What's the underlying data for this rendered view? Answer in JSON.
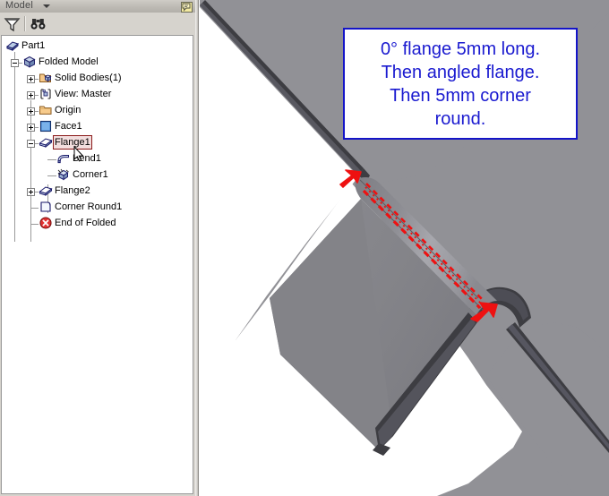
{
  "panel": {
    "title": "Model",
    "caret_icon": "chevron-down-icon",
    "dock_icon": "dock-pin-icon",
    "toolbar": [
      {
        "name": "filter-button",
        "icon": "filter-funnel-icon"
      },
      {
        "name": "find-button",
        "icon": "binoculars-icon"
      }
    ]
  },
  "tree": {
    "items": [
      {
        "label": "Part1",
        "icon": "part-icon",
        "indent": 0,
        "expander": "none",
        "selected": false
      },
      {
        "label": "Folded Model",
        "icon": "folded-model-icon",
        "indent": 1,
        "expander": "minus",
        "selected": false
      },
      {
        "label": "Solid Bodies(1)",
        "icon": "solid-bodies-icon",
        "indent": 2,
        "expander": "plus",
        "selected": false
      },
      {
        "label": "View: Master",
        "icon": "view-master-icon",
        "indent": 2,
        "expander": "plus",
        "selected": false
      },
      {
        "label": "Origin",
        "icon": "folder-icon",
        "indent": 2,
        "expander": "plus",
        "selected": false
      },
      {
        "label": "Face1",
        "icon": "face-icon",
        "indent": 2,
        "expander": "plus",
        "selected": false
      },
      {
        "label": "Flange1",
        "icon": "flange-icon",
        "indent": 2,
        "expander": "minus",
        "selected": true
      },
      {
        "label": "Bend1",
        "icon": "bend-icon",
        "indent": 3,
        "expander": "none",
        "selected": false
      },
      {
        "label": "Corner1",
        "icon": "corner-icon",
        "indent": 3,
        "expander": "none",
        "selected": false
      },
      {
        "label": "Flange2",
        "icon": "flange-icon",
        "indent": 2,
        "expander": "plus",
        "selected": false
      },
      {
        "label": "Corner Round1",
        "icon": "corner-round-icon",
        "indent": 2,
        "expander": "none",
        "selected": false
      },
      {
        "label": "End of Folded",
        "icon": "end-of-folded-icon",
        "indent": 2,
        "expander": "none",
        "selected": false
      }
    ]
  },
  "annotation": {
    "lines": [
      "0° flange 5mm long.",
      "Then angled flange.",
      "Then 5mm corner",
      "round."
    ],
    "border_color": "#1414c8",
    "text_color": "#1a1ad0"
  },
  "viewport": {
    "background": "#919196",
    "face_light": "#9a9aa0",
    "face_mid": "#838388",
    "face_dark": "#6e6e74",
    "edge_color": "#3d3d42",
    "highlight_color": "#ee1111",
    "selection_label": "bend-edge-highlight"
  },
  "cursor": {
    "icon": "arrow-cursor"
  }
}
